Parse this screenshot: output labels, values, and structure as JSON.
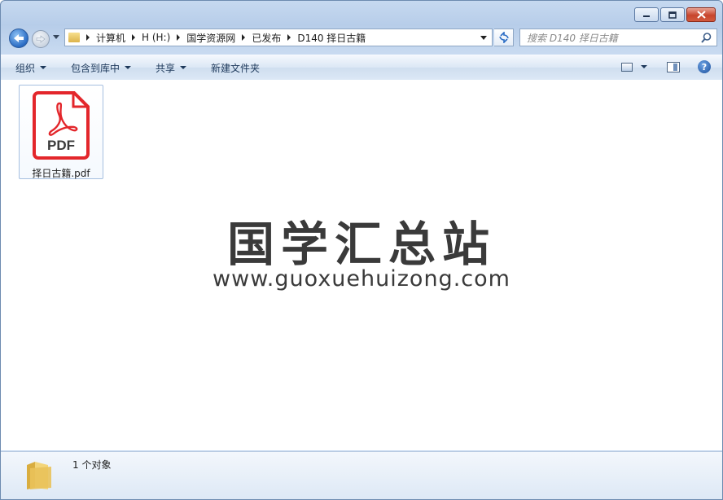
{
  "breadcrumbs": [
    "计算机",
    "H (H:)",
    "国学资源网",
    "已发布",
    "D140 择日古籍"
  ],
  "search": {
    "placeholder": "搜索 D140 择日古籍"
  },
  "toolbar": {
    "organize": "组织",
    "include_in_library": "包含到库中",
    "share": "共享",
    "new_folder": "新建文件夹"
  },
  "files": [
    {
      "name": "择日古籍.pdf",
      "icon": "pdf-file-icon",
      "icon_text": "PDF"
    }
  ],
  "watermark": {
    "title": "国学汇总站",
    "url": "www.guoxuehuizong.com"
  },
  "status": {
    "count_text": "1 个对象"
  },
  "colors": {
    "pdf_red": "#e3262b",
    "accent": "#2a6cc4"
  }
}
